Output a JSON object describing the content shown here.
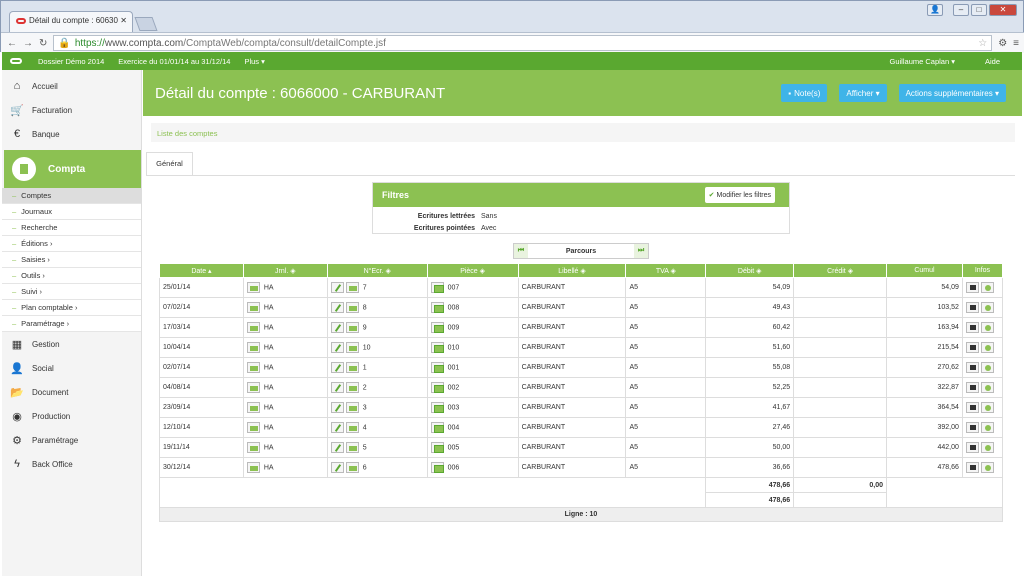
{
  "browser": {
    "tab_title": "Détail du compte : 60630",
    "url_scheme": "https://",
    "url_host": "www.compta.com",
    "url_path": "/ComptaWeb/compta/consult/detailCompte.jsf"
  },
  "topbar": {
    "dossier": "Dossier Démo 2014",
    "exercice": "Exercice du 01/01/14 au 31/12/14",
    "plus": "Plus ▾",
    "user": "Guillaume Caplan ▾",
    "aide": "Aide"
  },
  "sidebar": {
    "items_top": [
      {
        "label": "Accueil",
        "icon": "home-icon"
      },
      {
        "label": "Facturation",
        "icon": "cart-icon"
      },
      {
        "label": "Banque",
        "icon": "euro-icon"
      }
    ],
    "compta": "Compta",
    "subitems": [
      "Comptes",
      "Journaux",
      "Recherche",
      "Éditions ›",
      "Saisies ›",
      "Outils ›",
      "Suivi ›",
      "Plan comptable ›",
      "Paramétrage ›"
    ],
    "items_bottom": [
      {
        "label": "Gestion",
        "icon": "grid-icon"
      },
      {
        "label": "Social",
        "icon": "person-icon"
      },
      {
        "label": "Document",
        "icon": "folder-icon"
      },
      {
        "label": "Production",
        "icon": "globe-icon"
      },
      {
        "label": "Paramétrage",
        "icon": "gear-icon"
      },
      {
        "label": "Back Office",
        "icon": "bolt-icon"
      }
    ]
  },
  "header": {
    "title": "Détail du compte : 6066000 - CARBURANT",
    "notes": "Note(s)",
    "afficher": "Afficher ▾",
    "actions": "Actions supplémentaires ▾"
  },
  "breadcrumb": "Liste des comptes",
  "tab_general": "Général",
  "filtres": {
    "title": "Filtres",
    "button": "Modifier les filtres",
    "rows": [
      {
        "label": "Ecritures lettrées",
        "value": "Sans"
      },
      {
        "label": "Ecritures pointées",
        "value": "Avec"
      }
    ]
  },
  "parcours": "Parcours",
  "table": {
    "headers": [
      "Date ▴",
      "Jrnl. ◈",
      "N°Ecr. ◈",
      "Pièce ◈",
      "Libellé ◈",
      "TVA ◈",
      "Débit ◈",
      "Crédit ◈",
      "Cumul",
      "Infos"
    ],
    "rows": [
      [
        "25/01/14",
        "HA",
        "7",
        "007",
        "CARBURANT",
        "A5",
        "54,09",
        "",
        "54,09"
      ],
      [
        "07/02/14",
        "HA",
        "8",
        "008",
        "CARBURANT",
        "A5",
        "49,43",
        "",
        "103,52"
      ],
      [
        "17/03/14",
        "HA",
        "9",
        "009",
        "CARBURANT",
        "A5",
        "60,42",
        "",
        "163,94"
      ],
      [
        "10/04/14",
        "HA",
        "10",
        "010",
        "CARBURANT",
        "A5",
        "51,60",
        "",
        "215,54"
      ],
      [
        "02/07/14",
        "HA",
        "1",
        "001",
        "CARBURANT",
        "A5",
        "55,08",
        "",
        "270,62"
      ],
      [
        "04/08/14",
        "HA",
        "2",
        "002",
        "CARBURANT",
        "A5",
        "52,25",
        "",
        "322,87"
      ],
      [
        "23/09/14",
        "HA",
        "3",
        "003",
        "CARBURANT",
        "A5",
        "41,67",
        "",
        "364,54"
      ],
      [
        "12/10/14",
        "HA",
        "4",
        "004",
        "CARBURANT",
        "A5",
        "27,46",
        "",
        "392,00"
      ],
      [
        "19/11/14",
        "HA",
        "5",
        "005",
        "CARBURANT",
        "A5",
        "50,00",
        "",
        "442,00"
      ],
      [
        "30/12/14",
        "HA",
        "6",
        "006",
        "CARBURANT",
        "A5",
        "36,66",
        "",
        "478,66"
      ]
    ],
    "total_debit": "478,66",
    "total_credit": "0,00",
    "solde": "478,66",
    "ligne": "Ligne : 10"
  }
}
